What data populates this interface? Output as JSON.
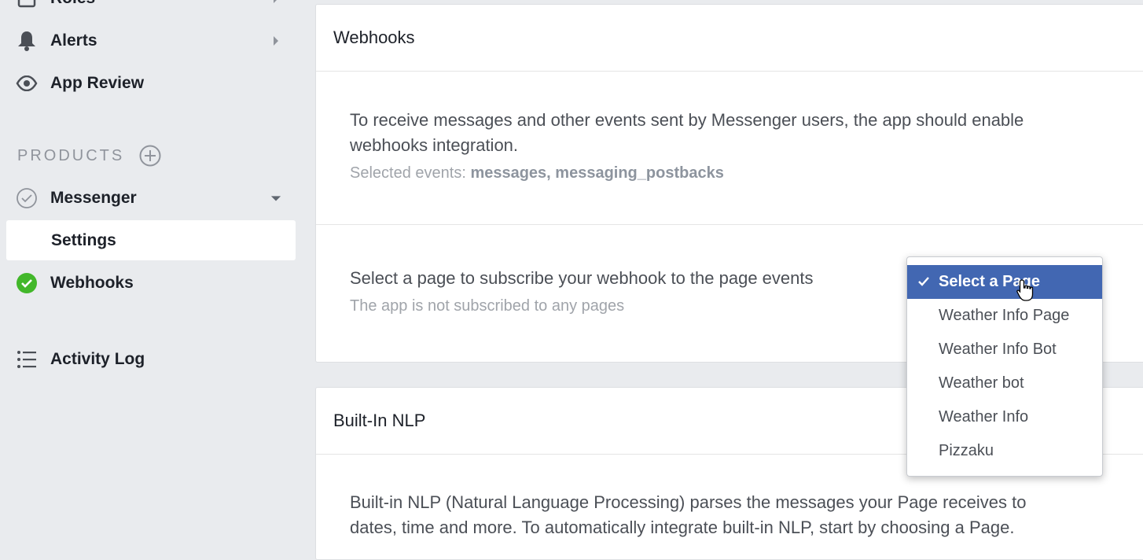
{
  "sidebar": {
    "top_items": [
      {
        "label": "Roles",
        "icon": "roles-icon"
      },
      {
        "label": "Alerts",
        "icon": "bell-icon"
      },
      {
        "label": "App Review",
        "icon": "eye-icon"
      }
    ],
    "products_header": "PRODUCTS",
    "messenger": {
      "label": "Messenger"
    },
    "settings": {
      "label": "Settings"
    },
    "webhooks": {
      "label": "Webhooks"
    },
    "activity_log": {
      "label": "Activity Log"
    }
  },
  "webhooks_card": {
    "title": "Webhooks",
    "description_line1": "To receive messages and other events sent by Messenger users, the app should enable",
    "description_line2": "webhooks integration.",
    "selected_events_label": "Selected events:",
    "selected_events_value": "messages, messaging_postbacks",
    "subscribe_text": "Select a page to subscribe your webhook to the page events",
    "subscribe_status": "The app is not subscribed to any pages"
  },
  "page_dropdown": {
    "selected": "Select a Page",
    "options": [
      "Weather Info Page",
      "Weather Info Bot",
      "Weather bot",
      "Weather Info",
      "Pizzaku"
    ]
  },
  "nlp_card": {
    "title": "Built-In NLP",
    "description_line1": "Built-in NLP (Natural Language Processing) parses the messages your Page receives to",
    "description_line2": "dates, time and more. To automatically integrate built-in NLP, start by choosing a Page."
  },
  "colors": {
    "background": "#e9ebee",
    "accent": "#4267b2",
    "success": "#42b72a"
  }
}
